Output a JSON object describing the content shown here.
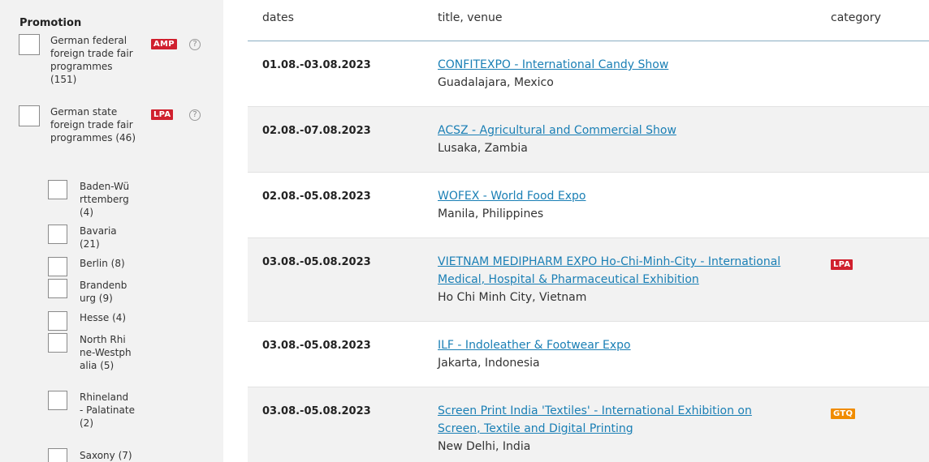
{
  "sidebar": {
    "title": "Promotion",
    "options": [
      {
        "label": "German federal foreign trade fair programmes (151)",
        "badge": "AMP",
        "help": "?"
      },
      {
        "label": "German state foreign trade fair programmes (46)",
        "badge": "LPA",
        "help": "?"
      }
    ],
    "states": [
      {
        "label": "Baden-Württemberg (4)"
      },
      {
        "label": "Bavaria (21)"
      },
      {
        "label": "Berlin (8)"
      },
      {
        "label": "Brandenburg (9)"
      },
      {
        "label": "Hesse (4)"
      },
      {
        "label": "North Rhine-Westphalia (5)"
      },
      {
        "label": "Rhineland - Palatinate (2)"
      },
      {
        "label": "Saxony (7)"
      }
    ]
  },
  "table": {
    "headers": {
      "dates": "dates",
      "title": "title, venue",
      "category": "category"
    },
    "rows": [
      {
        "dates": "01.08.-03.08.2023",
        "title": "CONFITEXPO - International Candy Show",
        "venue": "Guadalajara, Mexico",
        "category": ""
      },
      {
        "dates": "02.08.-07.08.2023",
        "title": "ACSZ - Agricultural and Commercial Show",
        "venue": "Lusaka, Zambia",
        "category": ""
      },
      {
        "dates": "02.08.-05.08.2023",
        "title": "WOFEX - World Food Expo",
        "venue": "Manila, Philippines",
        "category": ""
      },
      {
        "dates": "03.08.-05.08.2023",
        "title": "VIETNAM MEDIPHARM EXPO Ho-Chi-Minh-City - International Medical, Hospital & Pharmaceutical Exhibition",
        "venue": "Ho Chi Minh City, Vietnam",
        "category": "LPA"
      },
      {
        "dates": "03.08.-05.08.2023",
        "title": "ILF - Indoleather & Footwear Expo",
        "venue": "Jakarta, Indonesia",
        "category": ""
      },
      {
        "dates": "03.08.-05.08.2023",
        "title": "Screen Print India 'Textiles' - International Exhibition on Screen, Textile and Digital Printing",
        "venue": "New Delhi, India",
        "category": "GTQ"
      }
    ]
  },
  "colors": {
    "amp": "#d0202e",
    "lpa": "#d0202e",
    "gtq": "#f08c00",
    "link": "#1a7fb5",
    "header_line": "#8aaec3"
  }
}
